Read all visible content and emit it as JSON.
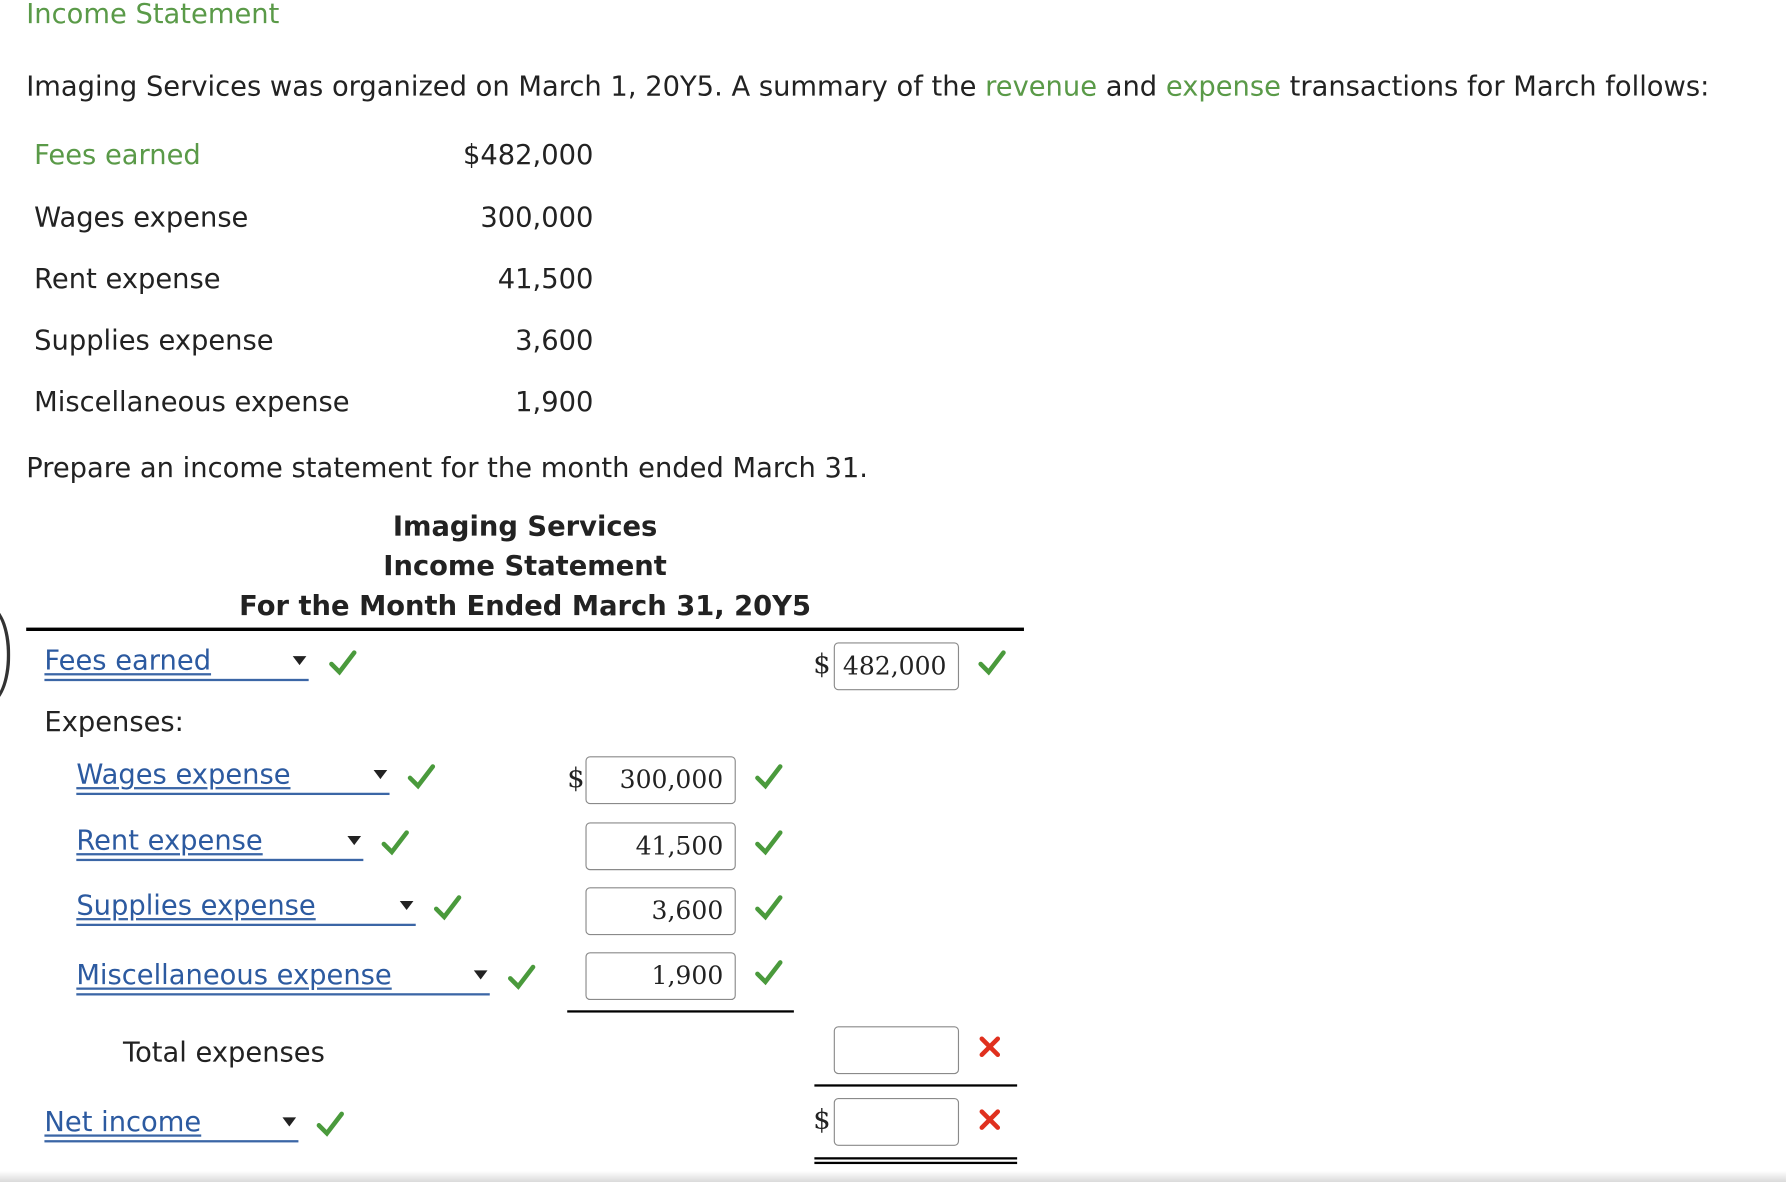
{
  "title": "Income Statement",
  "intro": {
    "part1": "Imaging Services was organized on March 1, 20Y5. A summary of the ",
    "link1": "revenue",
    "part2": " and ",
    "link2": "expense",
    "part3": " transactions for March follows:"
  },
  "given": [
    {
      "label": "Fees earned",
      "amount": "$482,000"
    },
    {
      "label": "Wages expense",
      "amount": "300,000"
    },
    {
      "label": "Rent expense",
      "amount": "41,500"
    },
    {
      "label": "Supplies expense",
      "amount": "3,600"
    },
    {
      "label": "Miscellaneous expense",
      "amount": "1,900"
    }
  ],
  "instruction": "Prepare an income statement for the month ended March 31.",
  "statement": {
    "company": "Imaging Services",
    "name": "Income Statement",
    "period": "For the Month Ended March 31, 20Y5",
    "revenue": {
      "select": "Fees earned",
      "dollar": "$",
      "value": "482,000"
    },
    "expenses_label": "Expenses:",
    "expenses": [
      {
        "select": "Wages expense",
        "dollar": "$",
        "value": "300,000"
      },
      {
        "select": "Rent expense",
        "dollar": "",
        "value": "41,500"
      },
      {
        "select": "Supplies expense",
        "dollar": "",
        "value": "3,600"
      },
      {
        "select": "Miscellaneous expense",
        "dollar": "",
        "value": "1,900"
      }
    ],
    "total_label": "Total expenses",
    "total_value": "",
    "net": {
      "select": "Net income",
      "dollar": "$",
      "value": ""
    }
  },
  "colors": {
    "accent_green": "#5a9a48",
    "check_green": "#4a9a3c",
    "x_red": "#e0301e",
    "link_blue": "#2c5aa0"
  }
}
